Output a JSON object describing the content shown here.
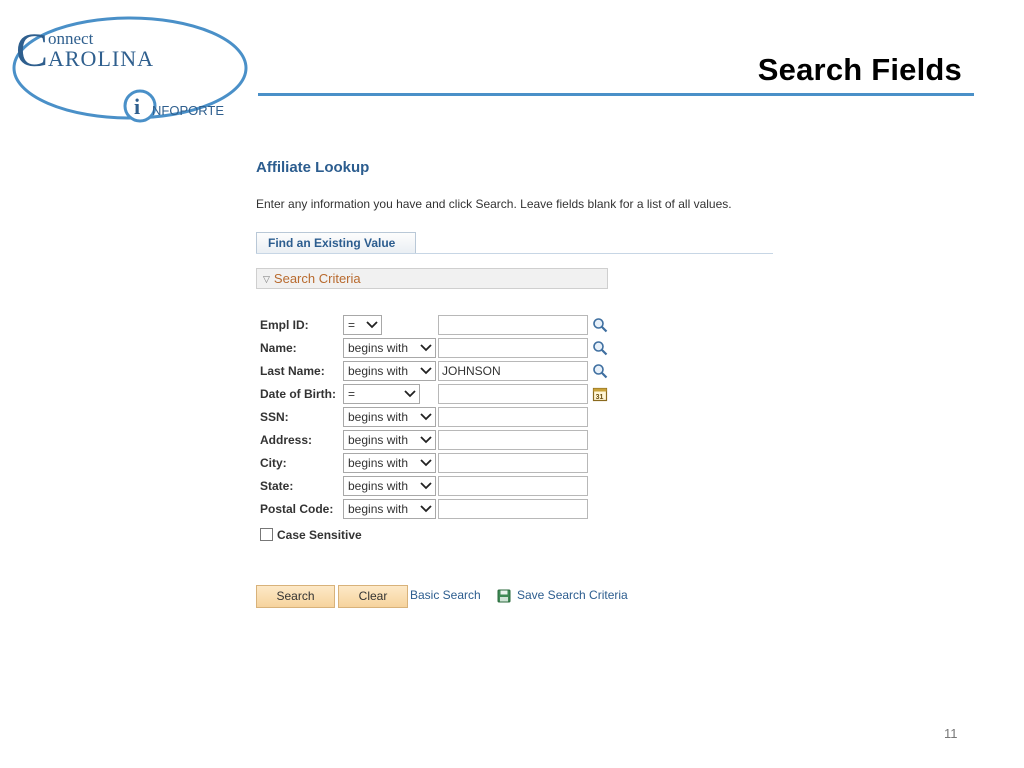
{
  "slide": {
    "title": "Search Fields",
    "page_number": "11",
    "logo": {
      "line1": "onnect",
      "line2": "AROLINA",
      "sub": "NFOPORTE"
    }
  },
  "panel": {
    "heading": "Affiliate Lookup",
    "instructions": "Enter any information you have and click Search. Leave fields blank for a list of all values.",
    "tab": "Find an Existing Value",
    "criteria_label": "Search Criteria",
    "fields": [
      {
        "label": "Empl ID:",
        "operator": "=",
        "value": "",
        "icon": "lookup-icon"
      },
      {
        "label": "Name:",
        "operator": "begins with",
        "value": "",
        "icon": "lookup-icon"
      },
      {
        "label": "Last Name:",
        "operator": "begins with",
        "value": "JOHNSON",
        "icon": "lookup-icon"
      },
      {
        "label": "Date of Birth:",
        "operator": "=",
        "value": "",
        "icon": "calendar-icon"
      },
      {
        "label": "SSN:",
        "operator": "begins with",
        "value": ""
      },
      {
        "label": "Address:",
        "operator": "begins with",
        "value": ""
      },
      {
        "label": "City:",
        "operator": "begins with",
        "value": ""
      },
      {
        "label": "State:",
        "operator": "begins with",
        "value": ""
      },
      {
        "label": "Postal Code:",
        "operator": "begins with",
        "value": ""
      }
    ],
    "case_sensitive_label": "Case Sensitive",
    "search_button": "Search",
    "clear_button": "Clear",
    "basic_search_link": "Basic Search",
    "save_criteria_link": "Save Search Criteria"
  },
  "colors": {
    "accent": "#4a90c8",
    "heading": "#2c5d8f",
    "criteria": "#b86a2e",
    "button": "#f6d39d"
  }
}
